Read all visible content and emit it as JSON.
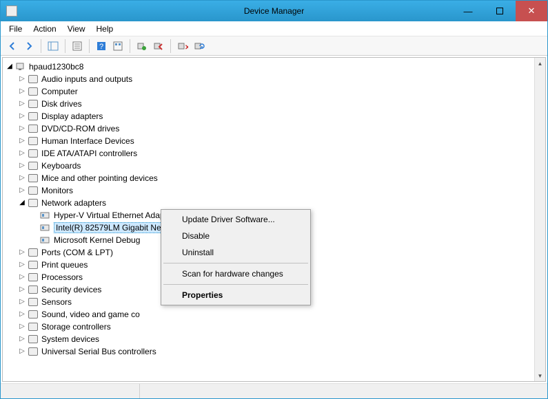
{
  "window": {
    "title": "Device Manager"
  },
  "menubar": {
    "file": "File",
    "action": "Action",
    "view": "View",
    "help": "Help"
  },
  "toolbar_icons": [
    "back-icon",
    "forward-icon",
    "show-hide-tree-icon",
    "properties-icon",
    "help-icon",
    "refresh-icon",
    "update-driver-icon",
    "enable-disable-icon",
    "uninstall-icon",
    "scan-hardware-icon"
  ],
  "tree": {
    "root": "hpaud1230bc8",
    "categories": [
      {
        "label": "Audio inputs and outputs"
      },
      {
        "label": "Computer"
      },
      {
        "label": "Disk drives"
      },
      {
        "label": "Display adapters"
      },
      {
        "label": "DVD/CD-ROM drives"
      },
      {
        "label": "Human Interface Devices"
      },
      {
        "label": "IDE ATA/ATAPI controllers"
      },
      {
        "label": "Keyboards"
      },
      {
        "label": "Mice and other pointing devices"
      },
      {
        "label": "Monitors"
      },
      {
        "label": "Network adapters",
        "expanded": true,
        "children": [
          {
            "label": "Hyper-V Virtual Ethernet Adapter #2"
          },
          {
            "label": "Intel(R) 82579LM Gigabit Network Connection",
            "selected": true
          },
          {
            "label": "Microsoft Kernel Debug"
          }
        ]
      },
      {
        "label": "Ports (COM & LPT)"
      },
      {
        "label": "Print queues"
      },
      {
        "label": "Processors"
      },
      {
        "label": "Security devices"
      },
      {
        "label": "Sensors"
      },
      {
        "label": "Sound, video and game co"
      },
      {
        "label": "Storage controllers"
      },
      {
        "label": "System devices"
      },
      {
        "label": "Universal Serial Bus controllers"
      }
    ]
  },
  "context_menu": {
    "update_driver": "Update Driver Software...",
    "disable": "Disable",
    "uninstall": "Uninstall",
    "scan": "Scan for hardware changes",
    "properties": "Properties"
  },
  "statusbar": {
    "text": ""
  }
}
